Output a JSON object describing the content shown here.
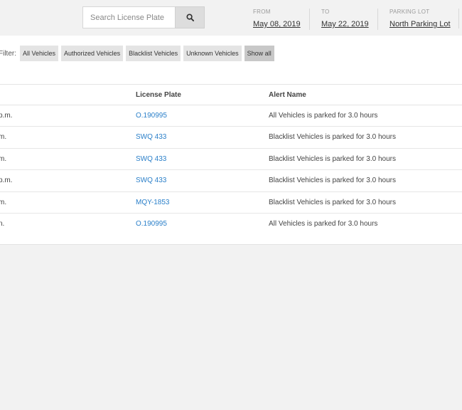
{
  "search": {
    "placeholder": "Search License Plate"
  },
  "header_filters": [
    {
      "label": "FROM",
      "value": "May 08, 2019"
    },
    {
      "label": "TO",
      "value": "May 22, 2019"
    },
    {
      "label": "PARKING LOT",
      "value": "North Parking Lot"
    }
  ],
  "filter_bar": {
    "label": "Filter:",
    "chips": [
      "All Vehicles",
      "Authorized Vehicles",
      "Blacklist Vehicles",
      "Unknown Vehicles",
      "Show all"
    ],
    "active": "Show all"
  },
  "table": {
    "columns": [
      "License Plate",
      "Alert Name"
    ],
    "rows": [
      {
        "time_fragment": "p.m.",
        "plate": "O.190995",
        "alert": "All Vehicles is parked for 3.0 hours"
      },
      {
        "time_fragment": "m.",
        "plate": "SWQ 433",
        "alert": "Blacklist Vehicles is parked for 3.0 hours"
      },
      {
        "time_fragment": "m.",
        "plate": "SWQ 433",
        "alert": "Blacklist Vehicles is parked for 3.0 hours"
      },
      {
        "time_fragment": "p.m.",
        "plate": "SWQ 433",
        "alert": "Blacklist Vehicles is parked for 3.0 hours"
      },
      {
        "time_fragment": "m.",
        "plate": "MQY-1853",
        "alert": "Blacklist Vehicles is parked for 3.0 hours"
      },
      {
        "time_fragment": "n.",
        "plate": "O.190995",
        "alert": "All Vehicles is parked for 3.0 hours"
      }
    ]
  },
  "icons": {
    "search_button": "search-icon"
  }
}
